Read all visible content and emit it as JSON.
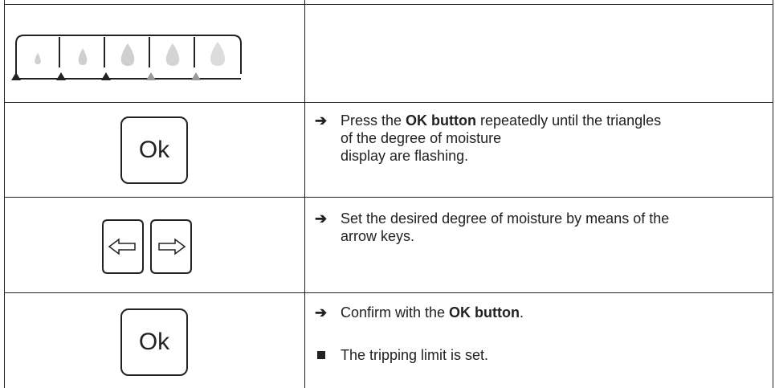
{
  "moisture_display": {
    "levels": 5,
    "active_triangles": 3,
    "colors": {
      "drop_light": "#c8c8c8",
      "drop_lighter": "#dcdcdc",
      "triangle_active": "#222222",
      "triangle_inactive": "#9a9a9a"
    }
  },
  "steps": [
    {
      "key_icon": "ok-key-icon",
      "key_label": "Ok",
      "bullet": "➔",
      "text_before": "Press the ",
      "text_bold": "OK button",
      "text_after_line1": " repeatedly until the triangles",
      "text_line2": "of the degree of moisture",
      "text_line3": "display are flashing."
    },
    {
      "key_icon": "arrow-keys-icon",
      "bullet": "➔",
      "text_line1": "Set the desired degree of moisture by means of the",
      "text_line2": "arrow keys."
    },
    {
      "key_icon": "ok-key-icon",
      "key_label": "Ok",
      "bullet": "➔",
      "text_before": "Confirm with the ",
      "text_bold": "OK button",
      "text_after": ".",
      "result_text": "The tripping limit is set."
    }
  ]
}
